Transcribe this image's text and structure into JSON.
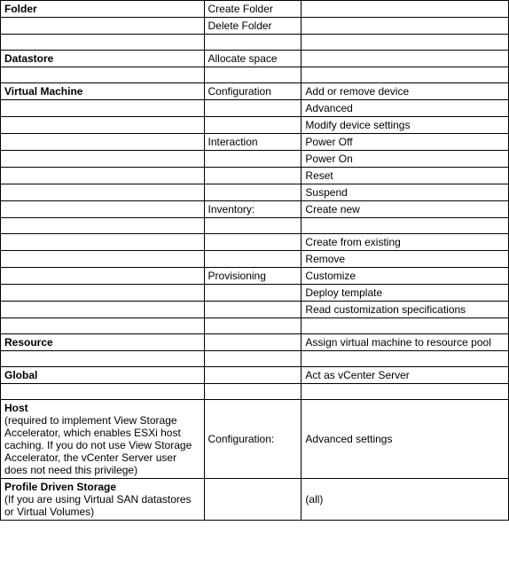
{
  "rows": [
    {
      "c1": "Folder",
      "c1Bold": true,
      "c2": "Create Folder",
      "c3": ""
    },
    {
      "c1": "",
      "c2": "Delete Folder",
      "c3": ""
    },
    {
      "c1": "",
      "c2": "",
      "c3": ""
    },
    {
      "c1": "Datastore",
      "c1Bold": true,
      "c2": "Allocate space",
      "c3": ""
    },
    {
      "c1": "",
      "c2": "",
      "c3": ""
    },
    {
      "c1": "Virtual Machine",
      "c1Bold": true,
      "c2": "Configuration",
      "c3": "Add or remove device"
    },
    {
      "c1": "",
      "c2": "",
      "c3": "Advanced"
    },
    {
      "c1": "",
      "c2": "",
      "c3": "Modify device settings"
    },
    {
      "c1": "",
      "c2": "Interaction",
      "c3": "Power Off"
    },
    {
      "c1": "",
      "c2": "",
      "c3": "Power On"
    },
    {
      "c1": "",
      "c2": "",
      "c3": "Reset"
    },
    {
      "c1": "",
      "c2": "",
      "c3": "Suspend"
    },
    {
      "c1": "",
      "c2": "Inventory:",
      "c3": "Create new"
    },
    {
      "c1": "",
      "c2": "",
      "c3": ""
    },
    {
      "c1": "",
      "c2": "",
      "c3": "Create from existing"
    },
    {
      "c1": "",
      "c2": "",
      "c3": "Remove"
    },
    {
      "c1": "",
      "c2": "Provisioning",
      "c3": "Customize"
    },
    {
      "c1": "",
      "c2": "",
      "c3": "Deploy template"
    },
    {
      "c1": "",
      "c2": "",
      "c3": "Read customization specifications"
    },
    {
      "c1": "",
      "c2": "",
      "c3": ""
    },
    {
      "c1": "Resource",
      "c1Bold": true,
      "c2": "",
      "c3": "Assign virtual machine to resource pool"
    },
    {
      "c1": "",
      "c2": "",
      "c3": ""
    },
    {
      "c1": "Global",
      "c1Bold": true,
      "c2": "",
      "c3": "Act as vCenter Server"
    },
    {
      "c1": "",
      "c2": "",
      "c3": ""
    },
    {
      "c1": "Host",
      "c1Bold": true,
      "c1Sub": "(required to implement View Storage Accelerator, which enables ESXi host caching. If you do not use View Storage Accelerator, the vCenter Server user does not need this privilege)",
      "c2": "Configuration:",
      "c2Align": "middle",
      "c3": "Advanced settings",
      "c3Align": "middle"
    },
    {
      "c1": "Profile Driven Storage",
      "c1Bold": true,
      "c1Sub": "(If you are using Virtual SAN datastores or Virtual Volumes)",
      "c2": "",
      "c3": "(all)",
      "c3Align": "middle"
    }
  ]
}
